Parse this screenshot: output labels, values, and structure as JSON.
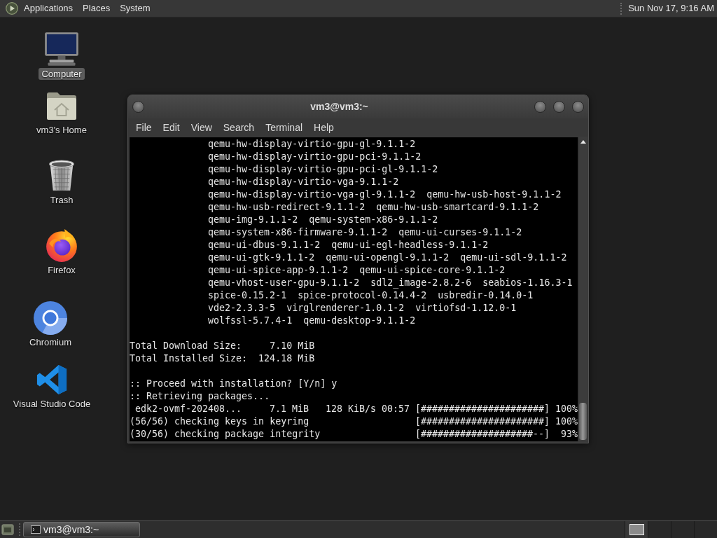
{
  "top_panel": {
    "menus": [
      "Applications",
      "Places",
      "System"
    ],
    "clock": "Sun Nov 17, 9:16 AM"
  },
  "desktop_icons": [
    {
      "label": "Computer",
      "kind": "monitor",
      "selected": true
    },
    {
      "label": "vm3's Home",
      "kind": "home_folder",
      "selected": false
    },
    {
      "label": "Trash",
      "kind": "trash_bin",
      "selected": false
    },
    {
      "label": "Firefox",
      "kind": "flame_globe",
      "selected": false
    },
    {
      "label": "Chromium",
      "kind": "ring_globe",
      "selected": false
    },
    {
      "label": "Visual Studio Code",
      "kind": "ribbon",
      "selected": false
    }
  ],
  "terminal_window": {
    "title": "vm3@vm3:~",
    "menu": [
      "File",
      "Edit",
      "View",
      "Search",
      "Terminal",
      "Help"
    ],
    "lines": [
      {
        "kind": "packages",
        "packages": [
          "qemu-hw-display-virtio-gpu-gl-9.1.1-2"
        ]
      },
      {
        "kind": "packages",
        "packages": [
          "qemu-hw-display-virtio-gpu-pci-9.1.1-2"
        ]
      },
      {
        "kind": "packages",
        "packages": [
          "qemu-hw-display-virtio-gpu-pci-gl-9.1.1-2"
        ]
      },
      {
        "kind": "packages",
        "packages": [
          "qemu-hw-display-virtio-vga-9.1.1-2"
        ]
      },
      {
        "kind": "packages",
        "packages": [
          "qemu-hw-display-virtio-vga-gl-9.1.1-2",
          "qemu-hw-usb-host-9.1.1-2"
        ]
      },
      {
        "kind": "packages",
        "packages": [
          "qemu-hw-usb-redirect-9.1.1-2",
          "qemu-hw-usb-smartcard-9.1.1-2"
        ]
      },
      {
        "kind": "packages",
        "packages": [
          "qemu-img-9.1.1-2",
          "qemu-system-x86-9.1.1-2"
        ]
      },
      {
        "kind": "packages",
        "packages": [
          "qemu-system-x86-firmware-9.1.1-2",
          "qemu-ui-curses-9.1.1-2"
        ]
      },
      {
        "kind": "packages",
        "packages": [
          "qemu-ui-dbus-9.1.1-2",
          "qemu-ui-egl-headless-9.1.1-2"
        ]
      },
      {
        "kind": "packages",
        "packages": [
          "qemu-ui-gtk-9.1.1-2",
          "qemu-ui-opengl-9.1.1-2",
          "qemu-ui-sdl-9.1.1-2"
        ]
      },
      {
        "kind": "packages",
        "packages": [
          "qemu-ui-spice-app-9.1.1-2",
          "qemu-ui-spice-core-9.1.1-2"
        ]
      },
      {
        "kind": "packages",
        "packages": [
          "qemu-vhost-user-gpu-9.1.1-2",
          "sdl2_image-2.8.2-6",
          "seabios-1.16.3-1"
        ]
      },
      {
        "kind": "packages",
        "packages": [
          "spice-0.15.2-1",
          "spice-protocol-0.14.4-2",
          "usbredir-0.14.0-1"
        ]
      },
      {
        "kind": "packages",
        "packages": [
          "vde2-2.3.3-5",
          "virglrenderer-1.0.1-2",
          "virtiofsd-1.12.0-1"
        ]
      },
      {
        "kind": "packages",
        "packages": [
          "wolfssl-5.7.4-1",
          "qemu-desktop-9.1.1-2"
        ]
      },
      {
        "kind": "blank"
      },
      {
        "kind": "total",
        "label": "Total Download Size:",
        "value": "7.10 MiB"
      },
      {
        "kind": "total",
        "label": "Total Installed Size:",
        "value": "124.18 MiB"
      },
      {
        "kind": "blank"
      },
      {
        "kind": "prompt",
        "text": ":: Proceed with installation? [Y/n]",
        "answer": "y"
      },
      {
        "kind": "message",
        "text": ":: Retrieving packages..."
      },
      {
        "kind": "download",
        "name": "edk2-ovmf-202408...",
        "size": "7.1 MiB",
        "speed": "128 KiB/s",
        "time": "00:57",
        "bar": "[######################]",
        "percent": "100%"
      },
      {
        "kind": "check",
        "text": "(56/56) checking keys in keyring",
        "bar": "[######################]",
        "percent": "100%"
      },
      {
        "kind": "check",
        "text": "(30/56) checking package integrity",
        "bar": "[####################--]",
        "percent": "93%"
      }
    ]
  },
  "taskbar": {
    "windows": [
      {
        "label": "vm3@vm3:~",
        "selected": true
      }
    ],
    "workspaces": [
      {
        "selected": true,
        "has_window": true
      },
      {
        "selected": false,
        "has_window": false
      },
      {
        "selected": false,
        "has_window": false
      },
      {
        "selected": false,
        "has_window": false
      }
    ]
  }
}
